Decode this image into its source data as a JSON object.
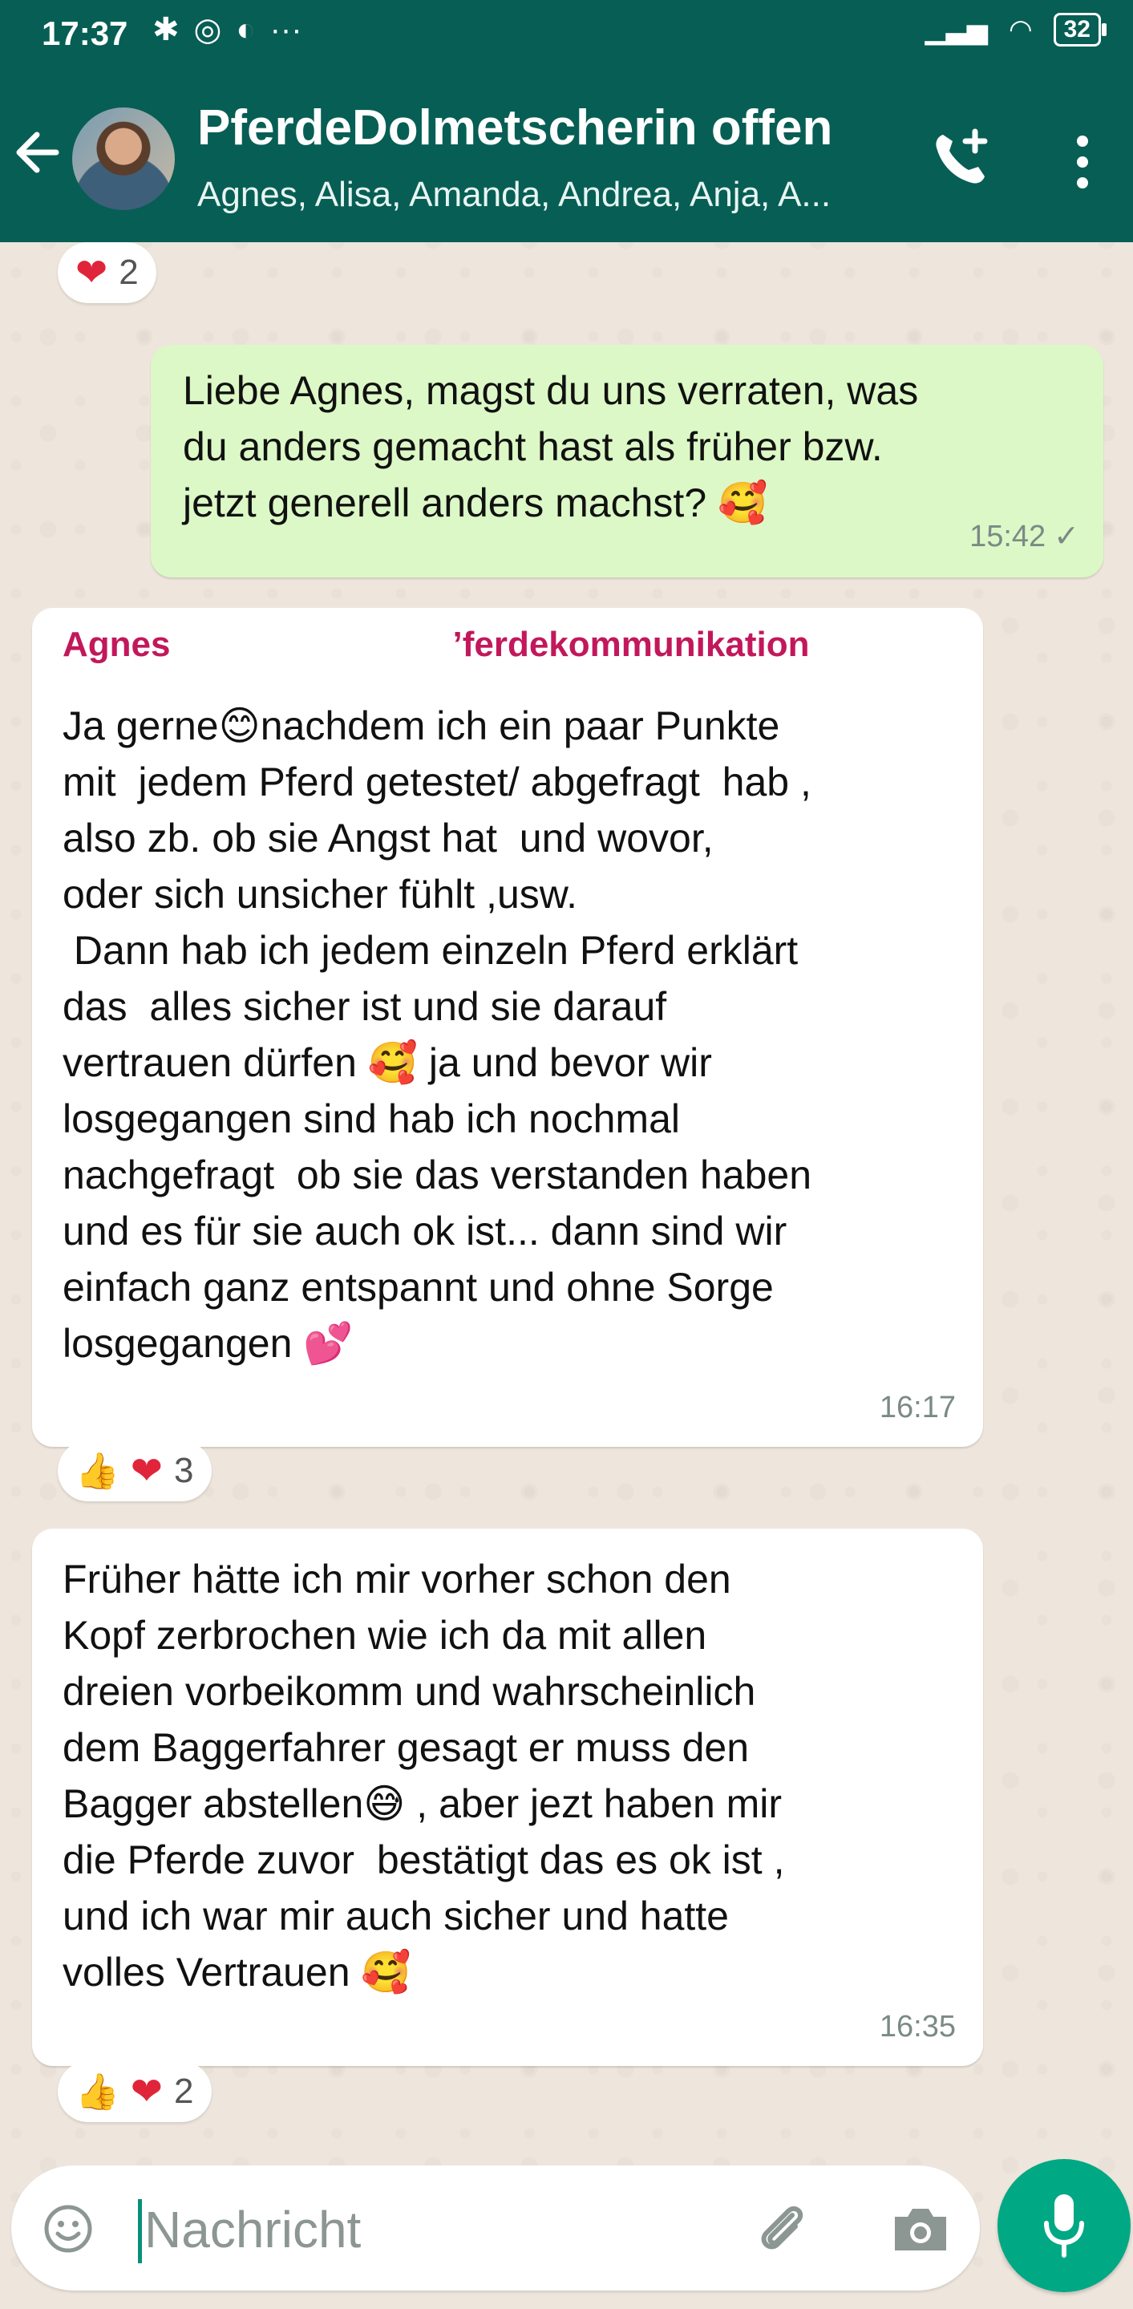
{
  "status_bar": {
    "time": "17:37",
    "left_icons": [
      "bluetooth-icon",
      "instagram-icon",
      "vpn-icon",
      "more-dots-icon"
    ],
    "battery": "32"
  },
  "header": {
    "title": "PferdeDolmetscherin offen",
    "subtitle": "Agnes, Alisa, Amanda, Andrea, Anja, A...",
    "accent_color": "#075e54"
  },
  "messages": [
    {
      "id": "reaction-top",
      "reactions": {
        "heart": "❤",
        "count": "2"
      }
    },
    {
      "id": "msg-out-1",
      "direction": "out",
      "text": "Liebe Agnes, magst du uns verraten, was\ndu anders gemacht hast als früher bzw.\njetzt generell anders machst? 🥰",
      "time": "15:42",
      "status": "✓"
    },
    {
      "id": "msg-in-1",
      "direction": "in",
      "sender": "Agnes",
      "sender_tag": "ʼferdekommunikation",
      "text": "Ja gerne😊nachdem ich ein paar Punkte\nmit  jedem Pferd getestet/ abgefragt  hab ,\nalso zb. ob sie Angst hat  und wovor,\noder sich unsicher fühlt ,usw.\n Dann hab ich jedem einzeln Pferd erklärt\ndas  alles sicher ist und sie darauf\nvertrauen dürfen 🥰 ja und bevor wir\nlosgegangen sind hab ich nochmal\nnachgefragt  ob sie das verstanden haben\nund es für sie auch ok ist... dann sind wir\neinfach ganz entspannt und ohne Sorge\nlosgegangen 💕",
      "time": "16:17",
      "reactions": {
        "thumb": "👍",
        "heart": "❤",
        "count": "3"
      }
    },
    {
      "id": "msg-in-2",
      "direction": "in",
      "text": "Früher hätte ich mir vorher schon den\nKopf zerbrochen wie ich da mit allen\ndreien vorbeikomm und wahrscheinlich\ndem Baggerfahrer gesagt er muss den\nBagger abstellen😅 , aber jezt haben mir\ndie Pferde zuvor  bestätigt das es ok ist ,\nund ich war mir auch sicher und hatte\nvolles Vertrauen 🥰",
      "time": "16:35",
      "reactions": {
        "thumb": "👍",
        "heart": "❤",
        "count": "2"
      }
    }
  ],
  "composer": {
    "placeholder": "Nachricht"
  },
  "colors": {
    "outgoing_bubble": "#dcf8c6",
    "incoming_bubble": "#ffffff",
    "sender_name": "#c2185b",
    "mic_button": "#00a884"
  }
}
